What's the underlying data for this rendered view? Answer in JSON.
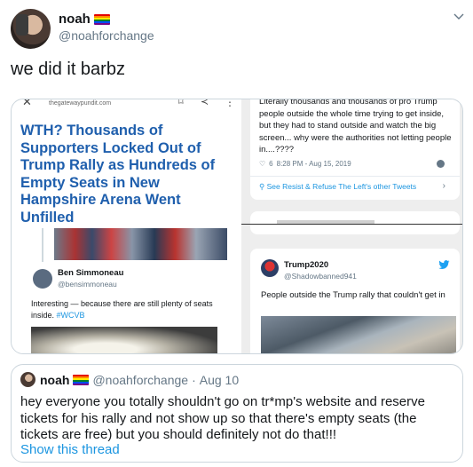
{
  "tweet": {
    "display_name": "noah",
    "handle": "@noahforchange",
    "text": "we did it barbz",
    "flag_colors": [
      "#e40303",
      "#ff8c00",
      "#ffed00",
      "#008026",
      "#004dff",
      "#750787"
    ]
  },
  "screenshot": {
    "left": {
      "site": "thegatewaypundit.com",
      "headline": "WTH? Thousands of Supporters Locked Out of Trump Rally as Hundreds of Empty Seats in New Hampshire Arena Went Unfilled",
      "reply_name": "Ben Simmoneau",
      "reply_handle": "@bensimmoneau",
      "reply_text": "Interesting — because there are still plenty of seats inside.",
      "reply_hashtag": "#WCVB"
    },
    "right": {
      "top_text": "Literally thousands and thousands of pro Trump people outside the whole time trying to get inside, but they had to stand outside and watch the big screen... why were the authorities not letting people in....????",
      "likes": "6",
      "timestamp": "8:28 PM - Aug 15, 2019",
      "see_more": "See Resist & Refuse The Left's other Tweets",
      "tweet_name": "Trump2020",
      "tweet_handle": "@Shadowbanned941",
      "tweet_text": "People outside the Trump rally that couldn't get in"
    }
  },
  "quote": {
    "display_name": "noah",
    "handle": "@noahforchange",
    "separator": "·",
    "date": "Aug 10",
    "text": "hey everyone you totally shouldn't go on tr*mp's website and reserve tickets for his rally and not show up so that there's empty seats (the tickets are free) but you should definitely not do that!!!",
    "show_thread": "Show this thread"
  },
  "colors": {
    "link": "#1b95e0",
    "secondary": "#657786",
    "headline": "#1f5fad"
  }
}
